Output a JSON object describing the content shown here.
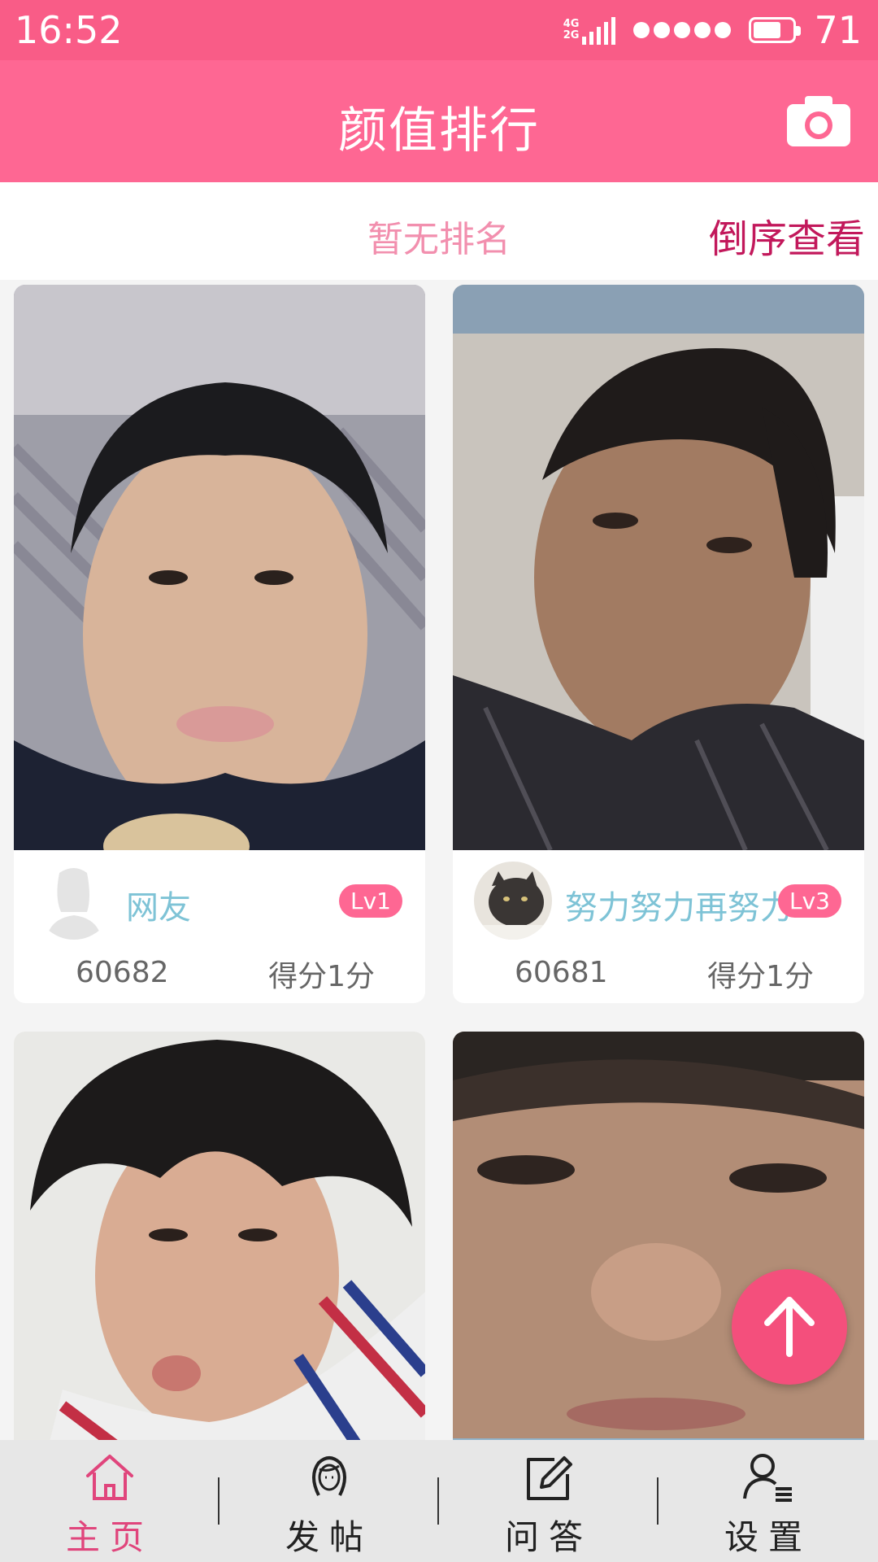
{
  "status_bar": {
    "time": "16:52",
    "network_top": "4G",
    "network_bottom": "2G",
    "battery_level": "71",
    "battery_fraction": 0.71
  },
  "header": {
    "title": "颜值排行",
    "camera_icon": "camera-icon"
  },
  "ranking": {
    "status": "暂无排名",
    "reverse_label": "倒序查看"
  },
  "cards": [
    {
      "name": "网友",
      "level": "Lv1",
      "id": "60682",
      "score": "得分1分",
      "avatar": "default-avatar-icon"
    },
    {
      "name": "努力努力再努力",
      "level": "Lv3",
      "id": "60681",
      "score": "得分1分",
      "avatar": "cat-avatar"
    },
    {
      "name": "",
      "level": "",
      "id": "",
      "score": ""
    },
    {
      "name": "",
      "level": "",
      "id": "",
      "score": ""
    }
  ],
  "fab": {
    "icon": "arrow-up-icon"
  },
  "tabs": [
    {
      "label": "主页",
      "icon": "home-icon",
      "active": true
    },
    {
      "label": "发帖",
      "icon": "woman-face-icon",
      "active": false
    },
    {
      "label": "问答",
      "icon": "edit-icon",
      "active": false
    },
    {
      "label": "设置",
      "icon": "user-list-icon",
      "active": false
    }
  ],
  "colors": {
    "accent": "#fe6793",
    "status_bar": "#f95c87",
    "name_blue": "#7ec3d6",
    "active_tab": "#e0457c"
  }
}
